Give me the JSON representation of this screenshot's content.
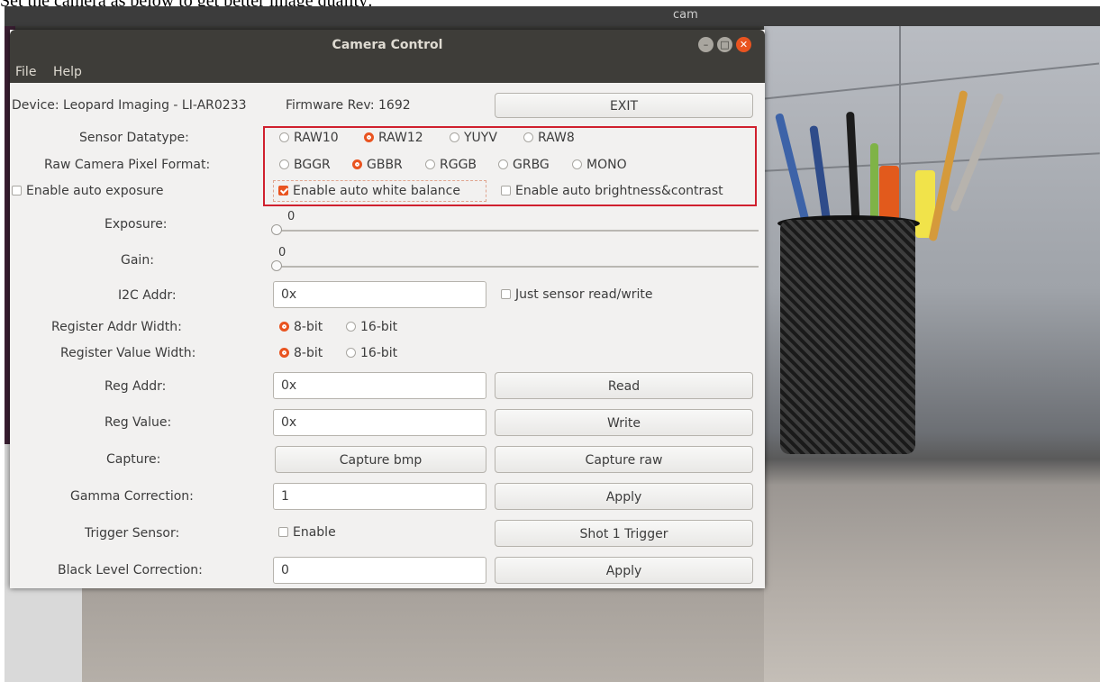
{
  "caption": "Set the camera as below to get better image quality:",
  "background_app": {
    "title": "cam"
  },
  "window": {
    "title": "Camera Control",
    "controls": {
      "minimize": "–",
      "maximize": "□",
      "close": "✕"
    },
    "menu": [
      "File",
      "Help"
    ]
  },
  "device": {
    "label": "Device: Leopard Imaging - LI-AR0233",
    "firmware": "Firmware Rev: 1692",
    "exit_label": "EXIT"
  },
  "sensor_datatype": {
    "label": "Sensor Datatype:",
    "options": [
      "RAW10",
      "RAW12",
      "YUYV",
      "RAW8"
    ],
    "selected": "RAW12"
  },
  "pixel_format": {
    "label": "Raw Camera Pixel Format:",
    "options": [
      "BGGR",
      "GBBR",
      "RGGB",
      "GRBG",
      "MONO"
    ],
    "selected": "GBBR"
  },
  "checks": {
    "auto_exposure": {
      "label": "Enable auto exposure",
      "checked": false
    },
    "auto_white_balance": {
      "label": "Enable auto white balance",
      "checked": true
    },
    "auto_brightness": {
      "label": "Enable auto brightness&contrast",
      "checked": false
    }
  },
  "exposure": {
    "label": "Exposure:",
    "value": "0"
  },
  "gain": {
    "label": "Gain:",
    "value": "0"
  },
  "i2c": {
    "label": "I2C Addr:",
    "value": "0x",
    "just_sensor": "Just sensor read/write"
  },
  "reg_addr_width": {
    "label": "Register Addr Width:",
    "options": [
      "8-bit",
      "16-bit"
    ],
    "selected": "8-bit"
  },
  "reg_value_width": {
    "label": "Register Value Width:",
    "options": [
      "8-bit",
      "16-bit"
    ],
    "selected": "8-bit"
  },
  "reg_addr": {
    "label": "Reg Addr:",
    "value": "0x",
    "button": "Read"
  },
  "reg_value": {
    "label": "Reg Value:",
    "value": "0x",
    "button": "Write"
  },
  "capture": {
    "label": "Capture:",
    "bmp": "Capture bmp",
    "raw": "Capture raw"
  },
  "gamma": {
    "label": "Gamma Correction:",
    "value": "1",
    "button": "Apply"
  },
  "trigger": {
    "label": "Trigger Sensor:",
    "enable": "Enable",
    "button": "Shot 1 Trigger"
  },
  "black_level": {
    "label": "Black Level Correction:",
    "value": "0",
    "button": "Apply"
  },
  "colors": {
    "accent": "#e95420",
    "highlight_box": "#d0202e",
    "titlebar": "#3e3d39"
  }
}
